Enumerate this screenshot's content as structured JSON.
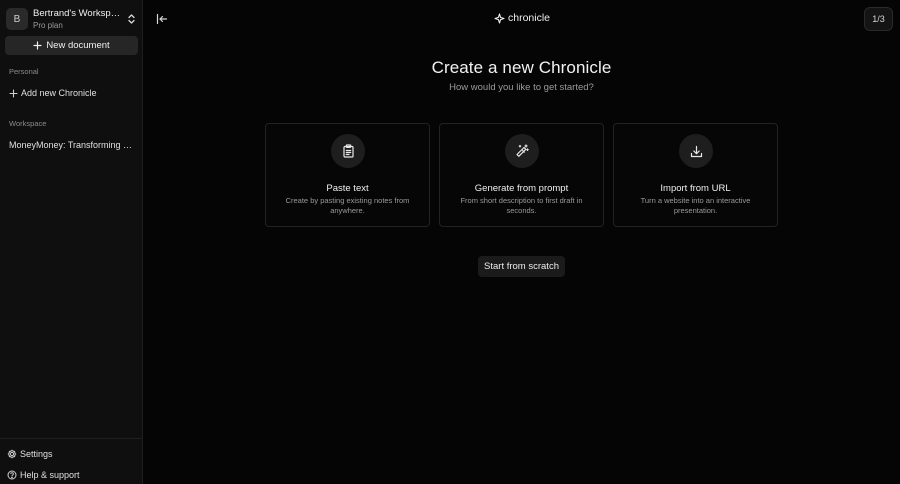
{
  "sidebar": {
    "workspace": {
      "avatar_letter": "B",
      "name": "Bertrand's Workspace",
      "plan": "Pro plan"
    },
    "new_document_label": "New document",
    "personal_label": "Personal",
    "personal_items": [
      {
        "label": "Add new Chronicle",
        "icon": "plus-icon"
      }
    ],
    "workspace_label": "Workspace",
    "workspace_items": [
      {
        "label": "MoneyMoney: Transforming Business"
      }
    ],
    "footer": {
      "settings_label": "Settings",
      "help_label": "Help & support"
    }
  },
  "header": {
    "brand": "chronicle",
    "page_counter": "1/3"
  },
  "main": {
    "title": "Create a new Chronicle",
    "subtitle": "How would you like to get started?",
    "options": [
      {
        "title": "Paste text",
        "description": "Create by pasting existing notes from anywhere.",
        "icon": "clipboard-icon"
      },
      {
        "title": "Generate from prompt",
        "description": "From short description to first draft in seconds.",
        "icon": "magic-wand-icon"
      },
      {
        "title": "Import from URL",
        "description": "Turn a website into an interactive presentation.",
        "icon": "download-icon"
      }
    ],
    "scratch_label": "Start from scratch"
  },
  "colors": {
    "background": "#050505",
    "sidebar": "#0f0f0f",
    "card_border": "#222222",
    "muted_text": "#9a9a9a"
  }
}
